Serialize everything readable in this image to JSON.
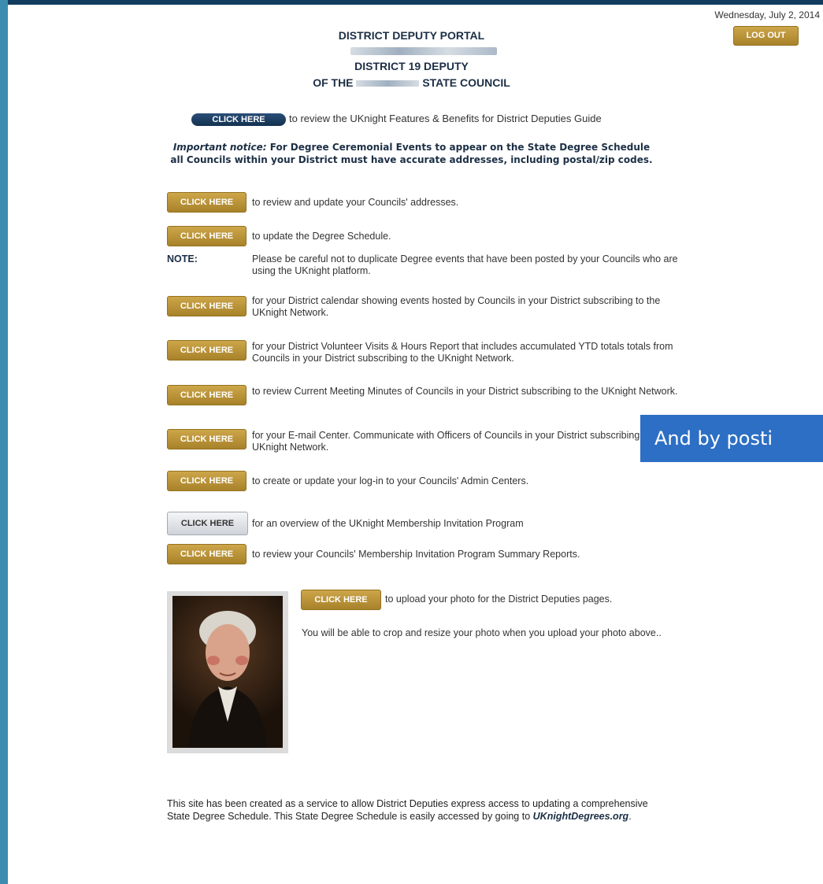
{
  "header": {
    "date": "Wednesday, July 2, 2014",
    "logout_label": "LOG OUT",
    "portal_title": "DISTRICT DEPUTY PORTAL",
    "district_line": "DISTRICT 19 DEPUTY",
    "council_prefix": "OF THE",
    "council_suffix": "STATE COUNCIL"
  },
  "guide": {
    "button_label": "CLICK HERE",
    "text": "to review the UKnight Features & Benefits for District Deputies Guide"
  },
  "notice": {
    "lead": "Important notice:",
    "line1": "For Degree Ceremonial Events to appear on the State Degree Schedule",
    "line2": "all Councils within your District must have accurate addresses, including postal/zip codes."
  },
  "actions": {
    "button_label": "CLICK HERE",
    "addresses": "to review and update your Councils' addresses.",
    "degree": "to update the Degree Schedule.",
    "note_label": "NOTE:",
    "note_text": "Please be careful not to duplicate Degree events that have been posted by your Councils who are using the UKnight platform.",
    "calendar": "for your District calendar showing events hosted by Councils in your District subscribing to the UKnight Network.",
    "volunteer": "for your District Volunteer Visits & Hours Report that includes accumulated YTD totals totals from Councils in your District subscribing to the UKnight Network.",
    "minutes": "to review Current Meeting Minutes of Councils in your District subscribing to the UKnight Network.",
    "email": "for your E-mail Center. Communicate with Officers of Councils in your District subscribing to the UKnight Network.",
    "login": "to create or update your log-in to your Councils' Admin Centers.",
    "overview": "for an overview of the UKnight Membership Invitation Program",
    "reports": "to review your Councils' Membership Invitation Program Summary Reports."
  },
  "photo": {
    "button_label": "CLICK HERE",
    "upload_text": "to upload your photo for the District Deputies pages.",
    "crop_text": "You will be able to crop and resize your photo when you upload your photo above.."
  },
  "footer": {
    "text": "This site has been created as a service to allow District Deputies express access to updating a comprehensive State Degree Schedule. This State Degree Schedule is easily accessed by going to",
    "link": "UKnightDegrees.org",
    "period": "."
  },
  "overlay": {
    "text": "And by posti"
  }
}
